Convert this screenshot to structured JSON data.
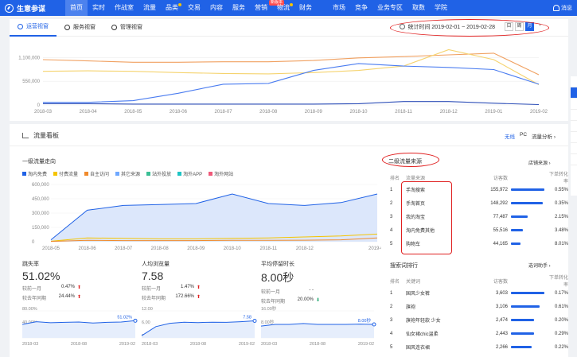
{
  "nav": {
    "logo": "生意参谋",
    "items": [
      "首页",
      "实时",
      "作战室",
      "流量",
      "品类",
      "交易",
      "内容",
      "服务",
      "营销",
      "物流",
      "财务",
      "市场",
      "竞争",
      "业务专区",
      "取数",
      "学院"
    ],
    "new_badge": "新版本",
    "message": "消息",
    "colors": {
      "bar": "#2062e6",
      "active": "#4c82ee"
    }
  },
  "overview": {
    "tabs": [
      "运营视窗",
      "服务视窗",
      "管理视窗"
    ],
    "date_range": "统计时间 2019-02-01 ~ 2019-02-28",
    "period_buttons": [
      "日",
      "周",
      "月"
    ],
    "prev": "‹",
    "chart_data": {
      "type": "line",
      "x": [
        "2018-03",
        "2018-04",
        "2018-05",
        "2018-06",
        "2018-07",
        "2018-08",
        "2018-09",
        "2018-10",
        "2018-11",
        "2018-12",
        "2019-01",
        "2019-02"
      ],
      "y_ticks": [
        "1,100,000",
        "550,000",
        "0"
      ],
      "ylim": [
        0,
        1400000
      ],
      "series": [
        {
          "color": "#f0a060",
          "values": [
            1050000,
            1020000,
            990000,
            990000,
            1000000,
            1000000,
            1030000,
            1090000,
            1120000,
            1160000,
            1200000,
            700000
          ]
        },
        {
          "color": "#f5d36e",
          "values": [
            780000,
            790000,
            780000,
            750000,
            730000,
            720000,
            750000,
            800000,
            900000,
            1280000,
            1050000,
            470000
          ]
        },
        {
          "color": "#4a7cf0",
          "values": [
            60000,
            60000,
            100000,
            270000,
            480000,
            500000,
            800000,
            960000,
            900000,
            870000,
            820000,
            480000
          ]
        },
        {
          "color": "#2e4fb8",
          "values": [
            30000,
            30000,
            20000,
            20000,
            20000,
            20000,
            20000,
            30000,
            80000,
            80000,
            40000,
            10000
          ]
        }
      ]
    }
  },
  "traffic": {
    "title": "流量看板",
    "tools": [
      "无线",
      "PC",
      "流量分析 ›"
    ],
    "section_title": "一级流量走向",
    "legend": [
      {
        "label": "淘内免费",
        "color": "#2062e6"
      },
      {
        "label": "付费流量",
        "color": "#f5c400"
      },
      {
        "label": "自主访问",
        "color": "#f08a2c"
      },
      {
        "label": "其它来源",
        "color": "#6fa8ff"
      },
      {
        "label": "站外投放",
        "color": "#3bbf95"
      },
      {
        "label": "淘外APP",
        "color": "#1ec4c4"
      },
      {
        "label": "淘外网站",
        "color": "#ef5a7a"
      }
    ],
    "chart_data": {
      "type": "area",
      "x": [
        "2018-05",
        "2018-06",
        "2018-07",
        "2018-08",
        "2018-09",
        "2018-10",
        "2018-11",
        "2018-12",
        "2019-01",
        "2019-02"
      ],
      "x_ticks": [
        "2018-05",
        "2018-06",
        "2018-07",
        "2018-08",
        "2018-09",
        "2018-10",
        "2018-11",
        "2018-12",
        "2019-02"
      ],
      "y_ticks": [
        "600,000",
        "450,000",
        "300,000",
        "150,000",
        "0"
      ],
      "ylim": [
        0,
        600000
      ],
      "series": [
        {
          "color": "#2062e6",
          "values": [
            20000,
            330000,
            380000,
            390000,
            400000,
            500000,
            400000,
            380000,
            410000,
            500000
          ]
        },
        {
          "color": "#f5c400",
          "values": [
            5000,
            40000,
            35000,
            30000,
            30000,
            35000,
            40000,
            50000,
            60000,
            80000
          ]
        },
        {
          "color": "#f08a2c",
          "values": [
            3000,
            15000,
            12000,
            12000,
            12000,
            14000,
            14000,
            16000,
            20000,
            40000
          ]
        }
      ]
    },
    "metrics": [
      {
        "name": "跳失率",
        "value": "51.02%",
        "cmp": [
          {
            "label": "较前一月",
            "value": "0.47%",
            "dir": "up"
          },
          {
            "label": "较去年同期",
            "value": "24.44%",
            "dir": "up"
          }
        ],
        "chart_data": {
          "type": "line",
          "x": [
            "2018-03",
            "2018-08",
            "2019-02"
          ],
          "y_ticks": [
            "80.00%",
            "40.00%",
            "0.00%"
          ],
          "ylim": [
            0,
            80
          ],
          "values": [
            40,
            48,
            45,
            46,
            47,
            44,
            46,
            47,
            51.02
          ],
          "end_label": "51.02%"
        }
      },
      {
        "name": "人均浏览量",
        "value": "7.58",
        "cmp": [
          {
            "label": "较前一月",
            "value": "1.47%",
            "dir": "up"
          },
          {
            "label": "较去年同期",
            "value": "172.66%",
            "dir": "up"
          }
        ],
        "chart_data": {
          "type": "line",
          "x": [
            "2018-03",
            "2018-08",
            "2019-02"
          ],
          "y_ticks": [
            "12.00",
            "6.00",
            "0.00"
          ],
          "ylim": [
            0,
            12
          ],
          "values": [
            1,
            5,
            6.5,
            7,
            6.8,
            7,
            6.9,
            7.2,
            7.58
          ],
          "end_label": "7.58"
        }
      },
      {
        "name": "平均停留时长",
        "value": "8.00秒",
        "cmp": [
          {
            "label": "较前一月",
            "value": "- -",
            "dir": ""
          },
          {
            "label": "较去年同期",
            "value": "20.00%",
            "dir": "down"
          }
        ],
        "chart_data": {
          "type": "line",
          "x": [
            "2018-03",
            "2018-08",
            "2019-02"
          ],
          "y_ticks": [
            "16.00秒",
            "8.00秒",
            "0.00秒"
          ],
          "ylim": [
            0,
            16
          ],
          "values": [
            7,
            8,
            8,
            8.5,
            8,
            8,
            8,
            8.2,
            8
          ],
          "end_label": "8.00秒"
        }
      }
    ]
  },
  "secondary": {
    "title": "二级流量来源",
    "link": "店铺来源 ›",
    "headers": [
      "排名",
      "流量来源",
      "访客数",
      "下单转化率"
    ],
    "rows": [
      {
        "rank": "1",
        "source": "手淘搜索",
        "visitors": "155,972",
        "visitors_num": 155972,
        "rate": "0.55%"
      },
      {
        "rank": "2",
        "source": "手淘首页",
        "visitors": "148,292",
        "visitors_num": 148292,
        "rate": "0.35%"
      },
      {
        "rank": "3",
        "source": "我的淘宝",
        "visitors": "77,487",
        "visitors_num": 77487,
        "rate": "2.15%"
      },
      {
        "rank": "4",
        "source": "淘内免费其他",
        "visitors": "55,516",
        "visitors_num": 55516,
        "rate": "3.48%"
      },
      {
        "rank": "5",
        "source": "购物车",
        "visitors": "44,165",
        "visitors_num": 44165,
        "rate": "8.01%"
      }
    ]
  },
  "search_rank": {
    "title": "搜索词排行",
    "link": "选词助手 ›",
    "headers": [
      "排名",
      "关键词",
      "访客数",
      "下单转化率"
    ],
    "rows": [
      {
        "rank": "1",
        "keyword": "国风少女裤",
        "visitors": "3,603",
        "visitors_num": 3603,
        "rate": "0.17%"
      },
      {
        "rank": "2",
        "keyword": "旗袍",
        "visitors": "3,106",
        "visitors_num": 3106,
        "rate": "0.61%"
      },
      {
        "rank": "3",
        "keyword": "旗袍年轻款 少女",
        "visitors": "2,474",
        "visitors_num": 2474,
        "rate": "0.20%"
      },
      {
        "rank": "4",
        "keyword": "仙女裙chic温柔",
        "visitors": "2,443",
        "visitors_num": 2443,
        "rate": "0.29%"
      },
      {
        "rank": "5",
        "keyword": "国风连衣裙",
        "visitors": "2,266",
        "visitors_num": 2266,
        "rate": "0.22%"
      }
    ]
  }
}
